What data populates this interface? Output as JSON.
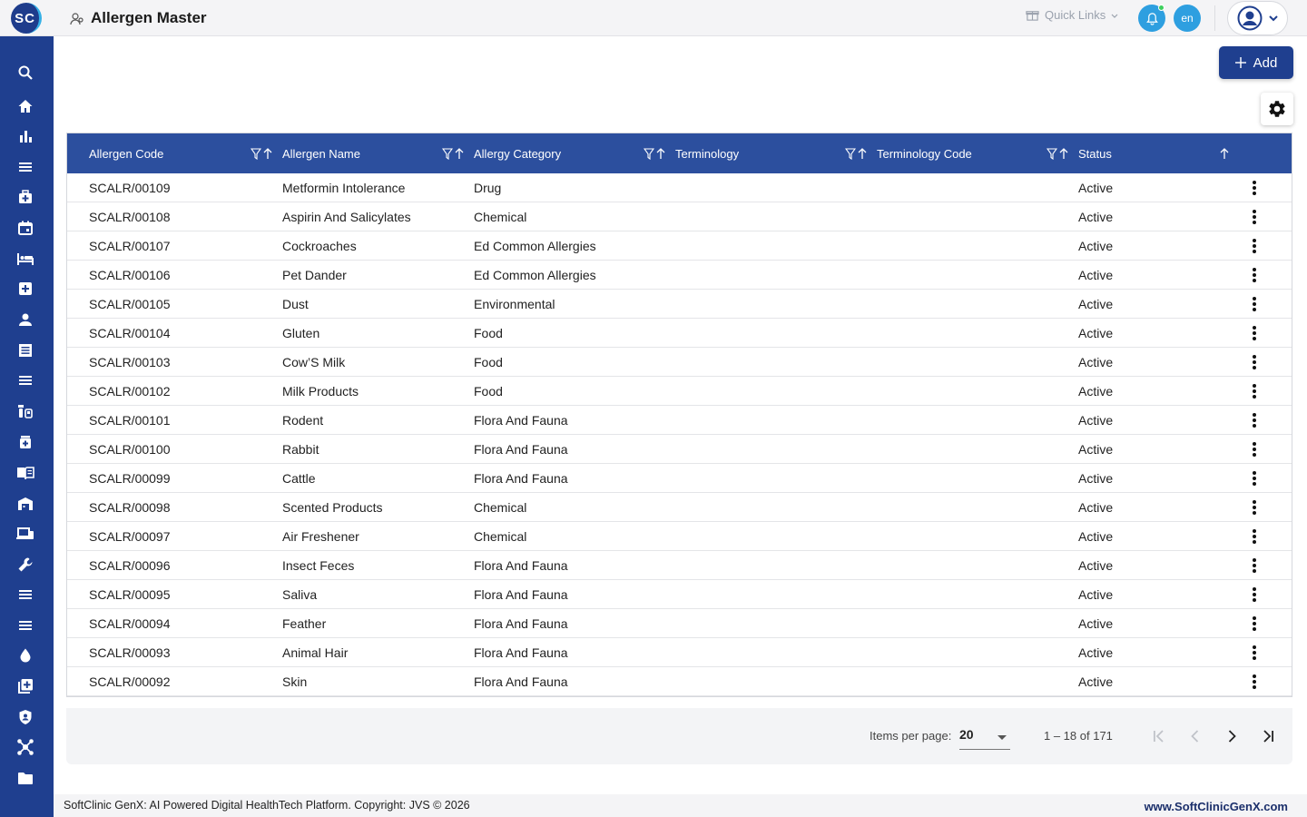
{
  "app": {
    "logo_text": "SC",
    "page_title": "Allergen Master"
  },
  "header": {
    "quick_links": "Quick Links",
    "language": "en"
  },
  "toolbar": {
    "add_label": "Add"
  },
  "table": {
    "columns": [
      "Allergen Code",
      "Allergen Name",
      "Allergy Category",
      "Terminology",
      "Terminology Code",
      "Status"
    ],
    "rows": [
      {
        "code": "SCALR/00109",
        "name": "Metformin Intolerance",
        "category": "Drug",
        "terminology": "",
        "term_code": "",
        "status": "Active"
      },
      {
        "code": "SCALR/00108",
        "name": "Aspirin And Salicylates",
        "category": "Chemical",
        "terminology": "",
        "term_code": "",
        "status": "Active"
      },
      {
        "code": "SCALR/00107",
        "name": "Cockroaches",
        "category": "Ed Common Allergies",
        "terminology": "",
        "term_code": "",
        "status": "Active"
      },
      {
        "code": "SCALR/00106",
        "name": "Pet Dander",
        "category": "Ed Common Allergies",
        "terminology": "",
        "term_code": "",
        "status": "Active"
      },
      {
        "code": "SCALR/00105",
        "name": "Dust",
        "category": "Environmental",
        "terminology": "",
        "term_code": "",
        "status": "Active"
      },
      {
        "code": "SCALR/00104",
        "name": "Gluten",
        "category": "Food",
        "terminology": "",
        "term_code": "",
        "status": "Active"
      },
      {
        "code": "SCALR/00103",
        "name": "Cow’S Milk",
        "category": "Food",
        "terminology": "",
        "term_code": "",
        "status": "Active"
      },
      {
        "code": "SCALR/00102",
        "name": "Milk Products",
        "category": "Food",
        "terminology": "",
        "term_code": "",
        "status": "Active"
      },
      {
        "code": "SCALR/00101",
        "name": "Rodent",
        "category": "Flora And Fauna",
        "terminology": "",
        "term_code": "",
        "status": "Active"
      },
      {
        "code": "SCALR/00100",
        "name": "Rabbit",
        "category": "Flora And Fauna",
        "terminology": "",
        "term_code": "",
        "status": "Active"
      },
      {
        "code": "SCALR/00099",
        "name": "Cattle",
        "category": "Flora And Fauna",
        "terminology": "",
        "term_code": "",
        "status": "Active"
      },
      {
        "code": "SCALR/00098",
        "name": "Scented Products",
        "category": "Chemical",
        "terminology": "",
        "term_code": "",
        "status": "Active"
      },
      {
        "code": "SCALR/00097",
        "name": "Air Freshener",
        "category": "Chemical",
        "terminology": "",
        "term_code": "",
        "status": "Active"
      },
      {
        "code": "SCALR/00096",
        "name": "Insect Feces",
        "category": "Flora And Fauna",
        "terminology": "",
        "term_code": "",
        "status": "Active"
      },
      {
        "code": "SCALR/00095",
        "name": "Saliva",
        "category": "Flora And Fauna",
        "terminology": "",
        "term_code": "",
        "status": "Active"
      },
      {
        "code": "SCALR/00094",
        "name": "Feather",
        "category": "Flora And Fauna",
        "terminology": "",
        "term_code": "",
        "status": "Active"
      },
      {
        "code": "SCALR/00093",
        "name": "Animal Hair",
        "category": "Flora And Fauna",
        "terminology": "",
        "term_code": "",
        "status": "Active"
      },
      {
        "code": "SCALR/00092",
        "name": "Skin",
        "category": "Flora And Fauna",
        "terminology": "",
        "term_code": "",
        "status": "Active"
      }
    ]
  },
  "pagination": {
    "items_per_page_label": "Items per page:",
    "items_per_page": "20",
    "range": "1 – 18 of 171"
  },
  "footer": {
    "copyright": "SoftClinic GenX: AI Powered Digital HealthTech Platform. Copyright: JVS © 2026",
    "website": "www.SoftClinicGenX.com"
  },
  "sidebar_icons": [
    "search-icon",
    "home-icon",
    "bar-chart-icon",
    "menu-icon",
    "medical-bag-icon",
    "calendar-icon",
    "bed-icon",
    "hospital-plus-icon",
    "person-icon",
    "receipt-icon",
    "list-icon",
    "medication-icon",
    "medicine-bottle-icon",
    "book-icon",
    "warehouse-icon",
    "devices-icon",
    "wrench-icon",
    "lines-icon",
    "lines-alt-icon",
    "water-drop-icon",
    "library-add-icon",
    "shield-icon",
    "molecule-icon",
    "folder-icon"
  ],
  "colors": {
    "sidebar": "#1f3f8f",
    "table_header": "#2c4f9e",
    "accent": "#2e9fe0"
  }
}
